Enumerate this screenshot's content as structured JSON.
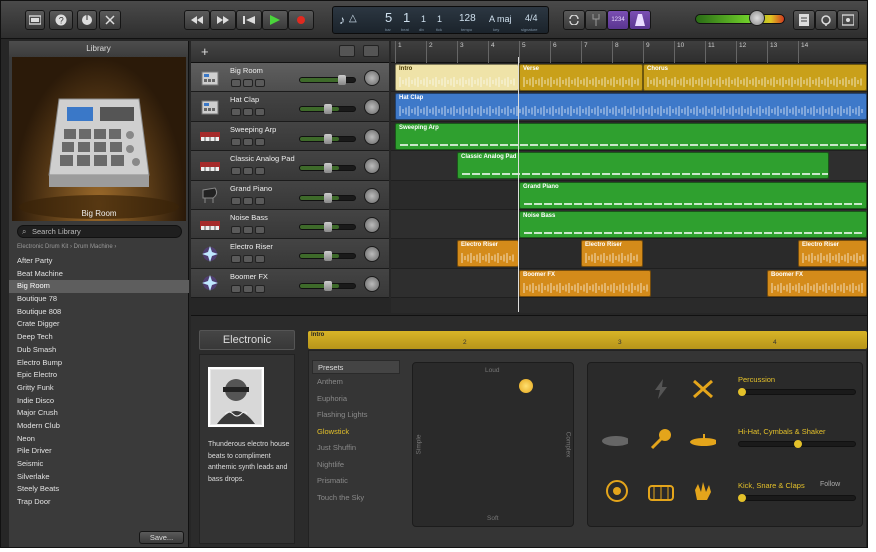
{
  "toolbar": {
    "lcd": {
      "bar": "5",
      "beat": "1",
      "division": "1",
      "tick": "1",
      "tempo": "128",
      "key": "A maj",
      "signature": "4/4",
      "labels": {
        "bar": "bar",
        "beat": "beat",
        "div": "div",
        "tick": "tick",
        "tempo": "tempo",
        "key": "key",
        "sig": "signature"
      }
    },
    "count_in_label": "1234"
  },
  "library": {
    "title": "Library",
    "preview_caption": "Big Room",
    "search_placeholder": "Search Library",
    "breadcrumb": "Electronic Drum Kit  ›  Drum Machine  ›",
    "items": [
      "After Party",
      "Beat Machine",
      "Big Room",
      "Boutique 78",
      "Boutique 808",
      "Crate Digger",
      "Deep Tech",
      "Dub Smash",
      "Electro Bump",
      "Epic Electro",
      "Gritty Funk",
      "Indie Disco",
      "Major Crush",
      "Modern Club",
      "Neon",
      "Pile Driver",
      "Seismic",
      "Silverlake",
      "Steely Beats",
      "Trap Door"
    ],
    "selected": "Big Room",
    "save_label": "Save..."
  },
  "tracks": [
    {
      "name": "Big Room",
      "icon": "drum-machine-icon",
      "selected": true
    },
    {
      "name": "Hat Clap",
      "icon": "drum-machine-icon",
      "selected": false
    },
    {
      "name": "Sweeping Arp",
      "icon": "synth-keyboard-icon",
      "selected": false
    },
    {
      "name": "Classic Analog Pad",
      "icon": "synth-keyboard-icon",
      "selected": false
    },
    {
      "name": "Grand Piano",
      "icon": "grand-piano-icon",
      "selected": false
    },
    {
      "name": "Noise Bass",
      "icon": "synth-keyboard-icon",
      "selected": false
    },
    {
      "name": "Electro Riser",
      "icon": "sparkle-icon",
      "selected": false
    },
    {
      "name": "Boomer FX",
      "icon": "sparkle-icon",
      "selected": false
    }
  ],
  "ruler": {
    "bars": [
      "1",
      "2",
      "3",
      "4",
      "5",
      "6",
      "7",
      "8",
      "9",
      "10",
      "11",
      "12",
      "13",
      "14"
    ]
  },
  "regions": {
    "intro": "Intro",
    "verse": "Verse",
    "chorus": "Chorus",
    "hat_clap": "Hat Clap",
    "sweeping_arp": "Sweeping Arp",
    "classic_pad": "Classic Analog Pad",
    "grand_piano": "Grand Piano",
    "noise_bass": "Noise Bass",
    "electro_riser": "Electro Riser",
    "boomer_fx": "Boomer FX"
  },
  "editor": {
    "genre": "Electronic",
    "description": "Thunderous electro house beats to compliment anthemic synth leads and bass drops.",
    "region_label": "Intro",
    "ruler": [
      "2",
      "3",
      "4"
    ],
    "presets_header": "Presets",
    "presets": [
      "Anthem",
      "Euphoria",
      "Flashing Lights",
      "Glowstick",
      "Just Shuffin",
      "Nightlife",
      "Prismatic",
      "Touch the Sky"
    ],
    "selected_preset": "Glowstick",
    "xy_labels": {
      "top": "Loud",
      "bottom": "Soft",
      "left": "Simple",
      "right": "Complex"
    },
    "kit": {
      "percussion": "Percussion",
      "hihat": "Hi-Hat, Cymbals & Shaker",
      "kick": "Kick, Snare & Claps",
      "follow": "Follow"
    }
  }
}
